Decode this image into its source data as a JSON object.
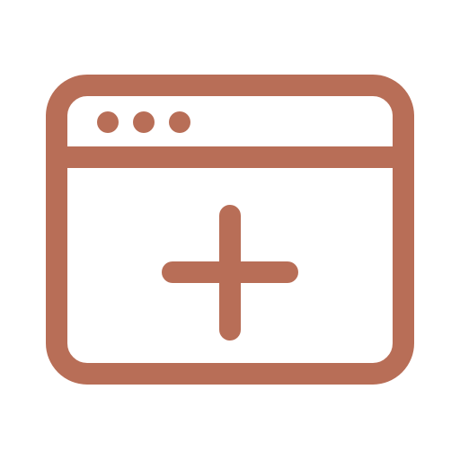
{
  "icon": {
    "name": "new-browser-window-icon",
    "stroke_color": "#B86E57",
    "background_color": "#FFFFFF"
  }
}
